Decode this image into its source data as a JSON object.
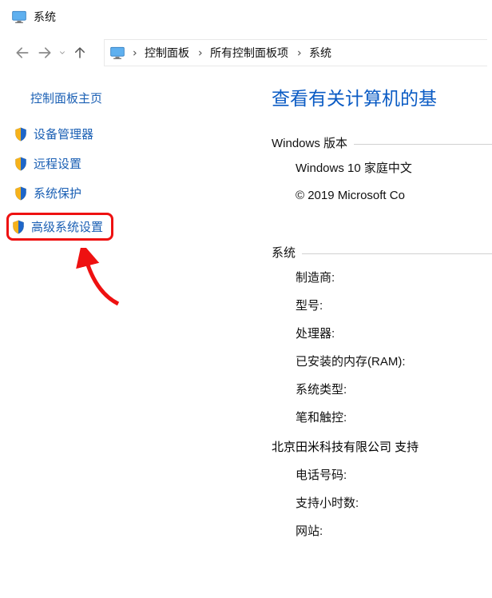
{
  "window": {
    "title": "系统"
  },
  "breadcrumb": {
    "items": [
      "控制面板",
      "所有控制面板项",
      "系统"
    ]
  },
  "sidebar": {
    "home": "控制面板主页",
    "links": [
      "设备管理器",
      "远程设置",
      "系统保护",
      "高级系统设置"
    ]
  },
  "main": {
    "heading": "查看有关计算机的基",
    "windows_edition": {
      "label": "Windows 版本",
      "line1": "Windows 10 家庭中文",
      "line2": "© 2019 Microsoft Co"
    },
    "system": {
      "label": "系统",
      "manufacturer_label": "制造商:",
      "model_label": "型号:",
      "processor_label": "处理器:",
      "ram_label": "已安装的内存(RAM):",
      "system_type_label": "系统类型:",
      "pen_touch_label": "笔和触控:"
    },
    "support": {
      "heading": "北京田米科技有限公司 支持",
      "phone_label": "电话号码:",
      "hours_label": "支持小时数:",
      "website_label": "网站:"
    }
  }
}
